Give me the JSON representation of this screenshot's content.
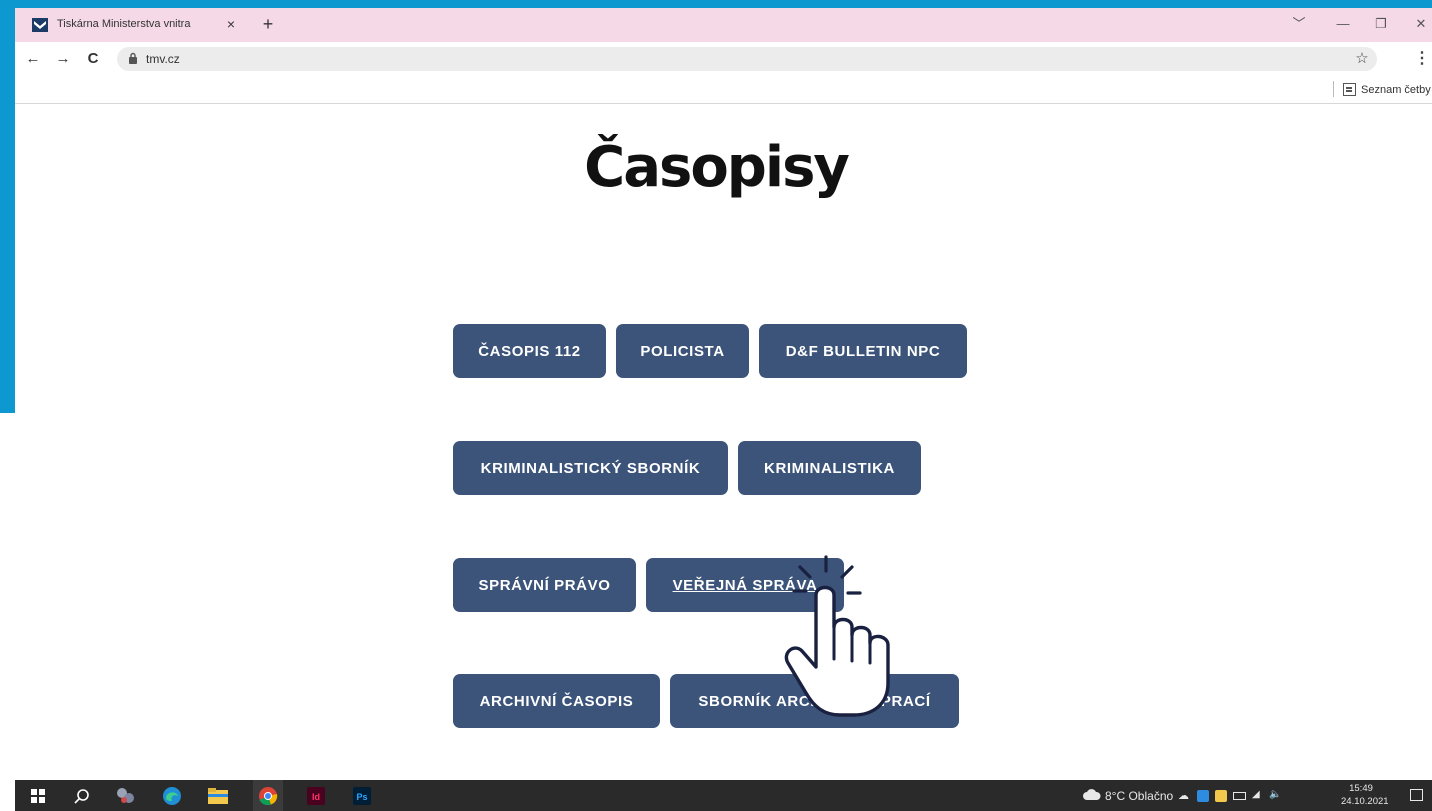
{
  "browser": {
    "tab_title": "Tiskárna Ministerstva vnitra",
    "tab_close": "×",
    "new_tab": "+",
    "window_controls": {
      "dropdown": "﹀",
      "minimize": "—",
      "maximize": "❐",
      "close": "✕"
    },
    "nav": {
      "back": "←",
      "forward": "→",
      "reload": "C"
    },
    "url": "tmv.cz",
    "star": "☆",
    "menu": "⋮",
    "reading_list_label": "Seznam četby"
  },
  "page": {
    "title": "Časopisy",
    "buttons": [
      {
        "label": "ČASOPIS 112"
      },
      {
        "label": "POLICISTA"
      },
      {
        "label": "D&F BULLETIN NPC"
      },
      {
        "label": "KRIMINALISTICKÝ SBORNÍK"
      },
      {
        "label": "KRIMINALISTIKA"
      },
      {
        "label": "SPRÁVNÍ PRÁVO"
      },
      {
        "label": "VEŘEJNÁ SPRÁVA",
        "hovered": true
      },
      {
        "label": "ARCHIVNÍ ČASOPIS"
      },
      {
        "label": "SBORNÍK ARCHIVNÍCH PRACÍ"
      }
    ]
  },
  "taskbar": {
    "weather": "8°C Oblačno",
    "time": "15:49",
    "date": "24.10.2021",
    "apps": [
      "windows-start",
      "search",
      "task-view",
      "edge",
      "file-explorer",
      "chrome",
      "indesign",
      "photoshop"
    ],
    "indesign_label": "Id",
    "photoshop_label": "Ps"
  },
  "colors": {
    "frame_blue": "#0d99d0",
    "tab_strip_pink": "#f5d9e6",
    "button_blue": "#3c547a",
    "taskbar": "#2a2a2a"
  }
}
